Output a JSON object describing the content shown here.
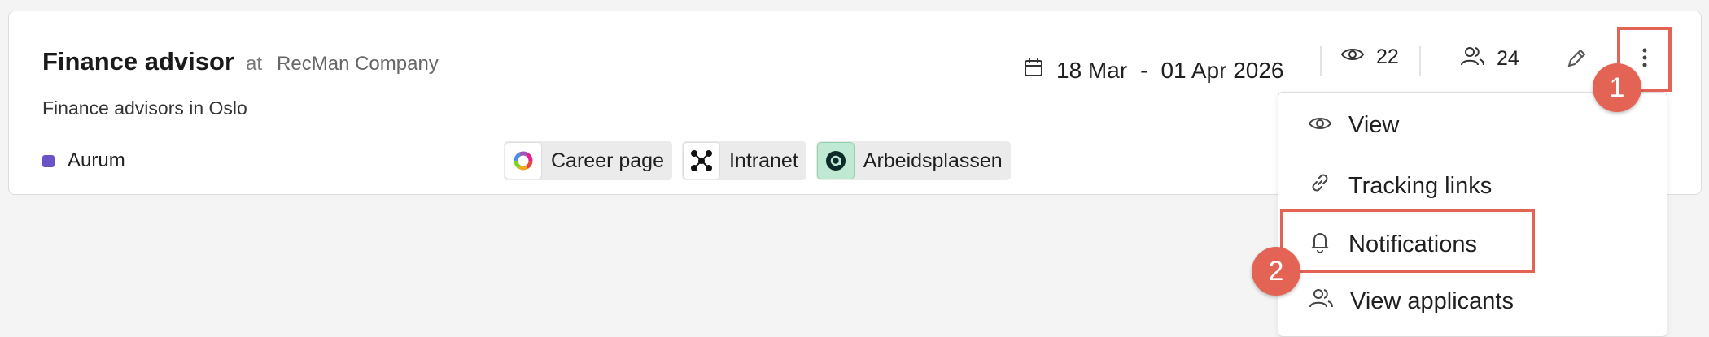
{
  "job": {
    "title": "Finance advisor",
    "at": "at",
    "company": "RecMan Company",
    "subtitle": "Finance advisors in Oslo",
    "tag": "Aurum",
    "tag_color": "#6b52c7"
  },
  "channels": [
    {
      "label": "Career page",
      "icon": "career-page-icon"
    },
    {
      "label": "Intranet",
      "icon": "intranet-icon"
    },
    {
      "label": "Arbeidsplassen",
      "icon": "arbeidsplassen-icon"
    }
  ],
  "period": {
    "start": "18 Mar",
    "separator": "-",
    "end": "01 Apr 2026"
  },
  "stats": {
    "views": "22",
    "applicants": "24"
  },
  "menu": {
    "items": [
      {
        "label": "View",
        "icon": "eye-icon"
      },
      {
        "label": "Tracking links",
        "icon": "link-icon"
      },
      {
        "label": "Notifications",
        "icon": "bell-icon"
      },
      {
        "label": "View applicants",
        "icon": "users-icon"
      }
    ]
  },
  "callouts": {
    "step1": "1",
    "step2": "2"
  },
  "colors": {
    "accent": "#e36454",
    "background": "#f4f4f4",
    "card": "#ffffff"
  }
}
